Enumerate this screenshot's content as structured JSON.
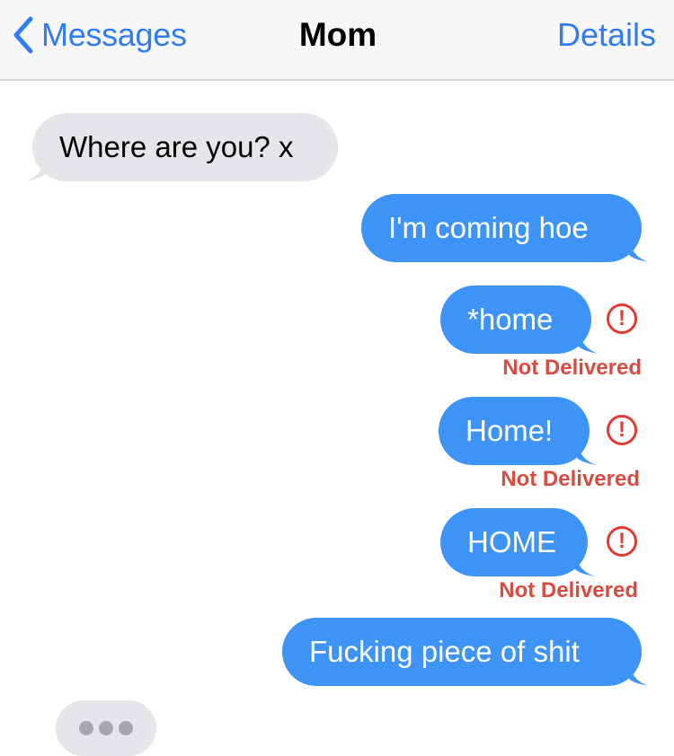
{
  "header": {
    "back_label": "Messages",
    "title": "Mom",
    "details_label": "Details",
    "accent_color": "#2f7cf6"
  },
  "messages": [
    {
      "direction": "incoming",
      "text": "Where are you? x"
    },
    {
      "direction": "outgoing",
      "text": "I'm coming hoe"
    },
    {
      "direction": "outgoing",
      "text": "*home",
      "status": "Not Delivered"
    },
    {
      "direction": "outgoing",
      "text": "Home!",
      "status": "Not Delivered"
    },
    {
      "direction": "outgoing",
      "text": "HOME",
      "status": "Not Delivered"
    },
    {
      "direction": "outgoing",
      "text": "Fucking piece of shit"
    }
  ],
  "alert_glyph": "!",
  "typing_indicator": {
    "icon": "typing-dots-icon"
  },
  "colors": {
    "incoming_bubble": "#e5e5ea",
    "outgoing_bubble": "#3d94f6",
    "error": "#e23b30"
  }
}
